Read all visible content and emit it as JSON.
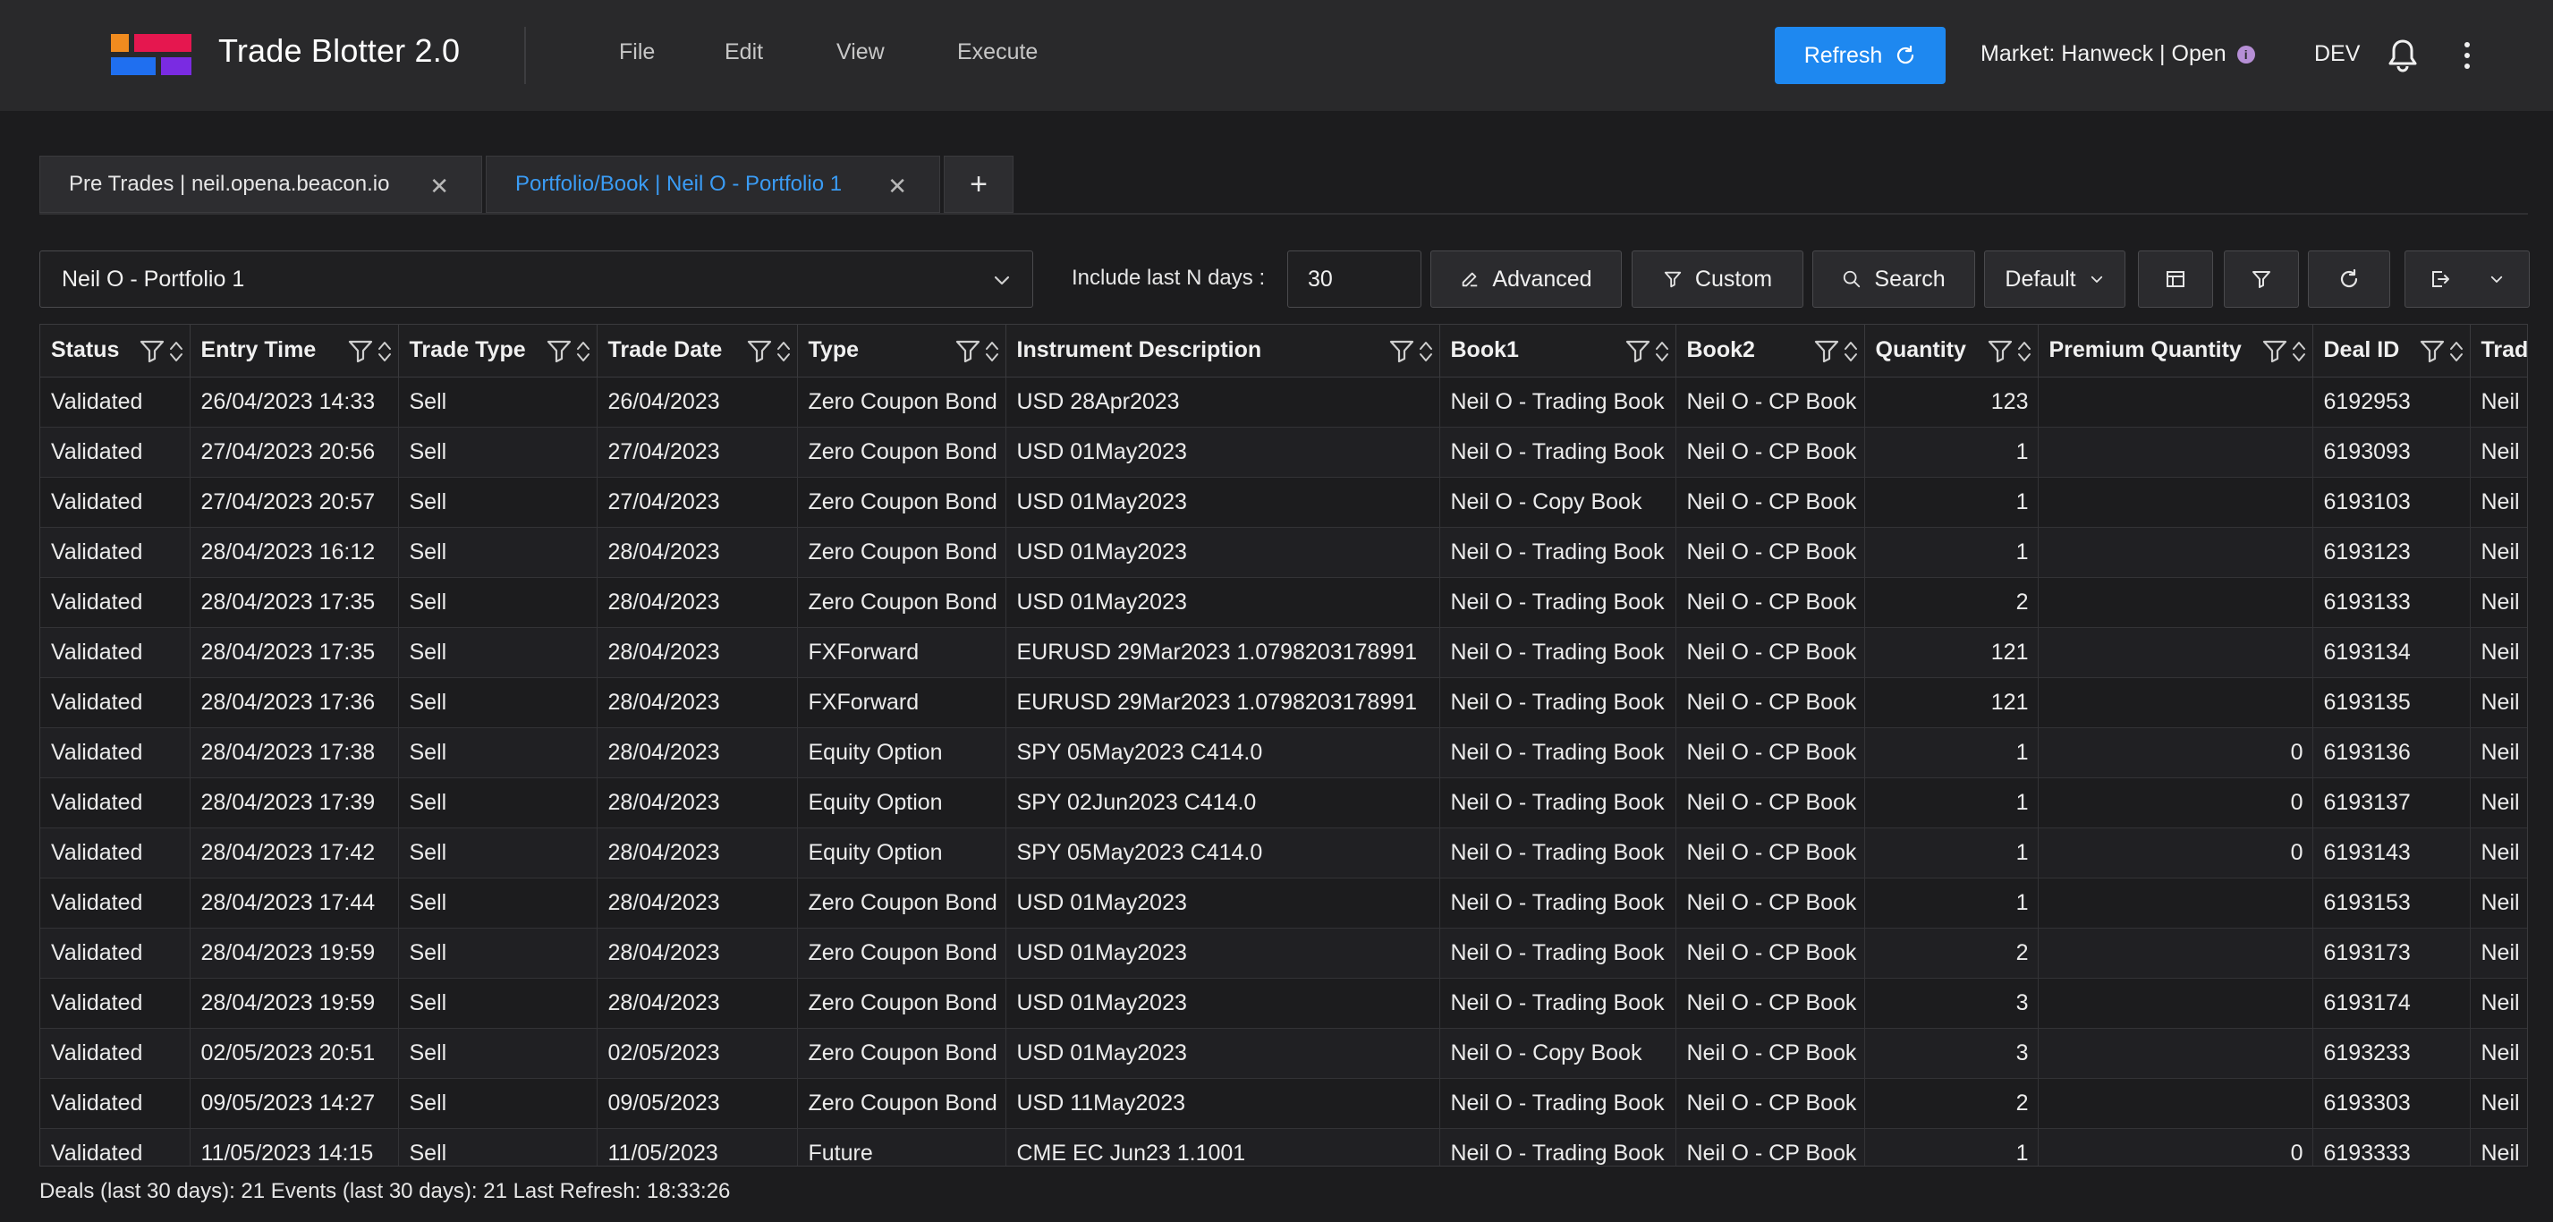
{
  "app": {
    "title": "Trade Blotter 2.0",
    "brand_colors": [
      "#f08b1f",
      "#e5174f",
      "#1f6ff0",
      "#7a2be2"
    ]
  },
  "menu": [
    "File",
    "Edit",
    "View",
    "Execute"
  ],
  "header": {
    "refresh_label": "Refresh",
    "market_label": "Market: Hanweck | Open",
    "env_label": "DEV",
    "accent_color": "#1e88f0"
  },
  "tabs": [
    {
      "label": "Pre Trades | neil.opena.beacon.io",
      "active": false
    },
    {
      "label": "Portfolio/Book | Neil O - Portfolio 1",
      "active": true
    }
  ],
  "toolbar": {
    "portfolio_value": "Neil O - Portfolio 1",
    "ndays_label": "Include last N days :",
    "ndays_value": "30",
    "advanced_label": "Advanced",
    "custom_label": "Custom",
    "search_label": "Search",
    "default_label": "Default"
  },
  "grid": {
    "columns": [
      "Status",
      "Entry Time",
      "Trade Type",
      "Trade Date",
      "Type",
      "Instrument Description",
      "Book1",
      "Book2",
      "Quantity",
      "Premium Quantity",
      "Deal ID",
      "Trad"
    ],
    "rows": [
      [
        "Validated",
        "26/04/2023 14:33",
        "Sell",
        "26/04/2023",
        "Zero Coupon Bond",
        "USD 28Apr2023",
        "Neil O - Trading Book",
        "Neil O - CP Book",
        "123",
        "",
        "6192953",
        "Neil"
      ],
      [
        "Validated",
        "27/04/2023 20:56",
        "Sell",
        "27/04/2023",
        "Zero Coupon Bond",
        "USD 01May2023",
        "Neil O - Trading Book",
        "Neil O - CP Book",
        "1",
        "",
        "6193093",
        "Neil"
      ],
      [
        "Validated",
        "27/04/2023 20:57",
        "Sell",
        "27/04/2023",
        "Zero Coupon Bond",
        "USD 01May2023",
        "Neil O - Copy Book",
        "Neil O - CP Book",
        "1",
        "",
        "6193103",
        "Neil"
      ],
      [
        "Validated",
        "28/04/2023 16:12",
        "Sell",
        "28/04/2023",
        "Zero Coupon Bond",
        "USD 01May2023",
        "Neil O - Trading Book",
        "Neil O - CP Book",
        "1",
        "",
        "6193123",
        "Neil"
      ],
      [
        "Validated",
        "28/04/2023 17:35",
        "Sell",
        "28/04/2023",
        "Zero Coupon Bond",
        "USD 01May2023",
        "Neil O - Trading Book",
        "Neil O - CP Book",
        "2",
        "",
        "6193133",
        "Neil"
      ],
      [
        "Validated",
        "28/04/2023 17:35",
        "Sell",
        "28/04/2023",
        "FXForward",
        "EURUSD 29Mar2023 1.0798203178991",
        "Neil O - Trading Book",
        "Neil O - CP Book",
        "121",
        "",
        "6193134",
        "Neil"
      ],
      [
        "Validated",
        "28/04/2023 17:36",
        "Sell",
        "28/04/2023",
        "FXForward",
        "EURUSD 29Mar2023 1.0798203178991",
        "Neil O - Trading Book",
        "Neil O - CP Book",
        "121",
        "",
        "6193135",
        "Neil"
      ],
      [
        "Validated",
        "28/04/2023 17:38",
        "Sell",
        "28/04/2023",
        "Equity Option",
        "SPY 05May2023 C414.0",
        "Neil O - Trading Book",
        "Neil O - CP Book",
        "1",
        "0",
        "6193136",
        "Neil"
      ],
      [
        "Validated",
        "28/04/2023 17:39",
        "Sell",
        "28/04/2023",
        "Equity Option",
        "SPY 02Jun2023 C414.0",
        "Neil O - Trading Book",
        "Neil O - CP Book",
        "1",
        "0",
        "6193137",
        "Neil"
      ],
      [
        "Validated",
        "28/04/2023 17:42",
        "Sell",
        "28/04/2023",
        "Equity Option",
        "SPY 05May2023 C414.0",
        "Neil O - Trading Book",
        "Neil O - CP Book",
        "1",
        "0",
        "6193143",
        "Neil"
      ],
      [
        "Validated",
        "28/04/2023 17:44",
        "Sell",
        "28/04/2023",
        "Zero Coupon Bond",
        "USD 01May2023",
        "Neil O - Trading Book",
        "Neil O - CP Book",
        "1",
        "",
        "6193153",
        "Neil"
      ],
      [
        "Validated",
        "28/04/2023 19:59",
        "Sell",
        "28/04/2023",
        "Zero Coupon Bond",
        "USD 01May2023",
        "Neil O - Trading Book",
        "Neil O - CP Book",
        "2",
        "",
        "6193173",
        "Neil"
      ],
      [
        "Validated",
        "28/04/2023 19:59",
        "Sell",
        "28/04/2023",
        "Zero Coupon Bond",
        "USD 01May2023",
        "Neil O - Trading Book",
        "Neil O - CP Book",
        "3",
        "",
        "6193174",
        "Neil"
      ],
      [
        "Validated",
        "02/05/2023 20:51",
        "Sell",
        "02/05/2023",
        "Zero Coupon Bond",
        "USD 01May2023",
        "Neil O - Copy Book",
        "Neil O - CP Book",
        "3",
        "",
        "6193233",
        "Neil"
      ],
      [
        "Validated",
        "09/05/2023 14:27",
        "Sell",
        "09/05/2023",
        "Zero Coupon Bond",
        "USD 11May2023",
        "Neil O - Trading Book",
        "Neil O - CP Book",
        "2",
        "",
        "6193303",
        "Neil"
      ],
      [
        "Validated",
        "11/05/2023 14:15",
        "Sell",
        "11/05/2023",
        "Future",
        "CME EC Jun23 1.1001",
        "Neil O - Trading Book",
        "Neil O - CP Book",
        "1",
        "0",
        "6193333",
        "Neil"
      ]
    ]
  },
  "footer": {
    "status_text": "Deals (last 30 days): 21 Events (last 30 days): 21 Last Refresh: 18:33:26"
  }
}
